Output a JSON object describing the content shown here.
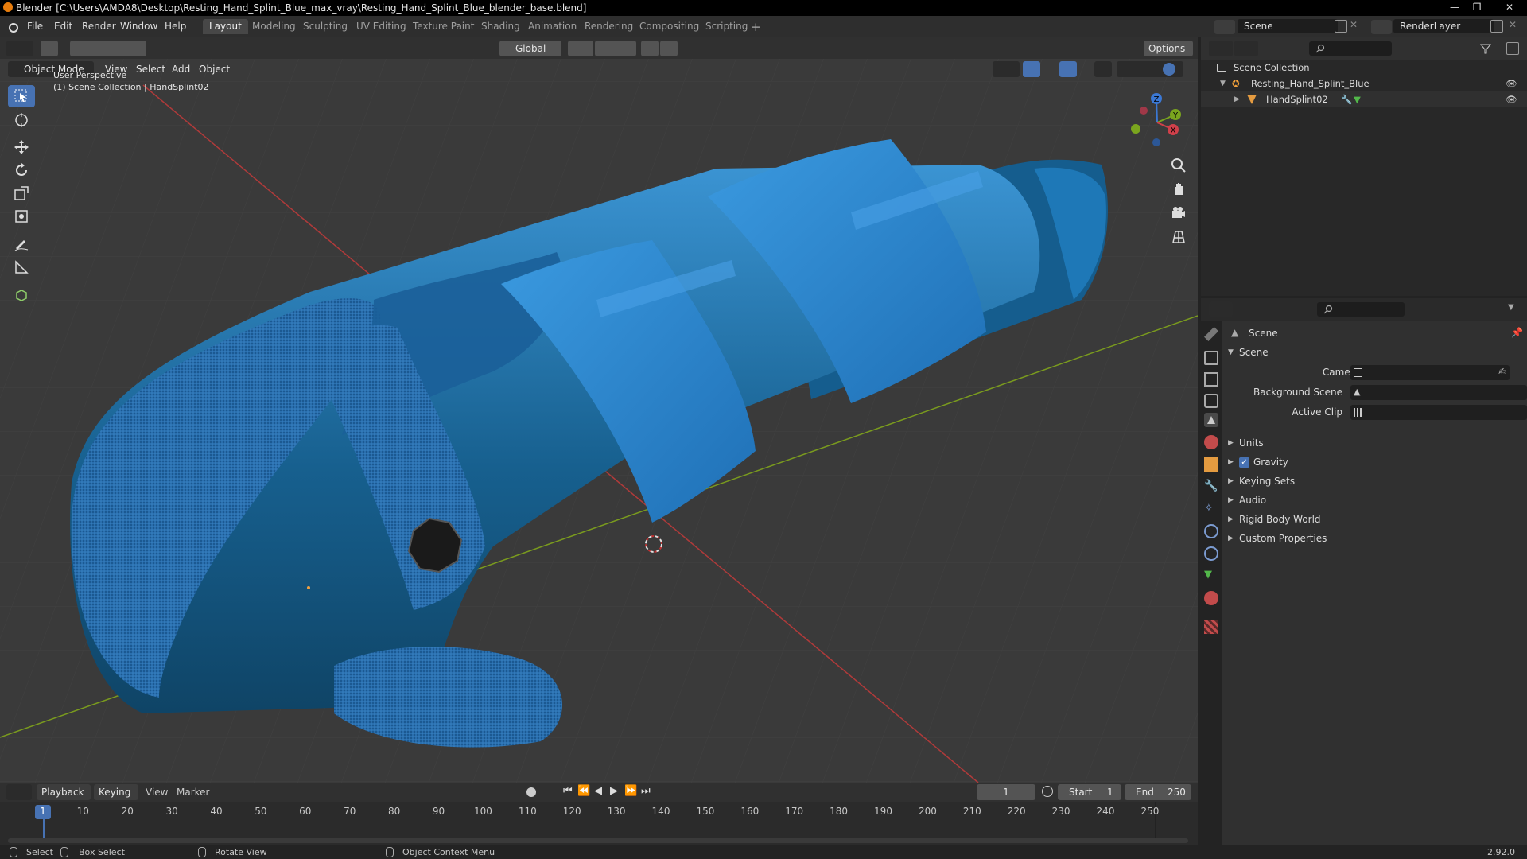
{
  "window": {
    "title": "Blender [C:\\Users\\AMDA8\\Desktop\\Resting_Hand_Splint_Blue_max_vray\\Resting_Hand_Splint_Blue_blender_base.blend]"
  },
  "menu": {
    "items": [
      "File",
      "Edit",
      "Render",
      "Window",
      "Help"
    ],
    "workspaces": [
      "Layout",
      "Modeling",
      "Sculpting",
      "UV Editing",
      "Texture Paint",
      "Shading",
      "Animation",
      "Rendering",
      "Compositing",
      "Scripting"
    ],
    "active_workspace": "Layout",
    "scene_name": "Scene",
    "view_layer": "RenderLayer"
  },
  "viewport": {
    "options_label": "Options",
    "transform_orientation": "Global",
    "mode": "Object Mode",
    "header_menus": [
      "View",
      "Select",
      "Add",
      "Object"
    ],
    "overlay_line1": "User Perspective",
    "overlay_line2": "(1) Scene Collection | HandSplint02",
    "gizmo_axes": {
      "x": "X",
      "y": "Y",
      "z": "Z"
    }
  },
  "outliner": {
    "root": "Scene Collection",
    "items": [
      {
        "name": "Resting_Hand_Splint_Blue"
      },
      {
        "name": "HandSplint02"
      }
    ]
  },
  "properties": {
    "context_title": "Scene",
    "panel_title": "Scene",
    "fields": [
      {
        "label": "Camera"
      },
      {
        "label": "Background Scene"
      },
      {
        "label": "Active Clip"
      }
    ],
    "subpanels": [
      "Units",
      "Gravity",
      "Keying Sets",
      "Audio",
      "Rigid Body World",
      "Custom Properties"
    ],
    "gravity_checked": true
  },
  "timeline": {
    "menus": [
      "Playback",
      "Keying",
      "View",
      "Marker"
    ],
    "current_frame": "1",
    "start_label": "Start",
    "start_value": "1",
    "end_label": "End",
    "end_value": "250",
    "ruler": [
      "1",
      "10",
      "20",
      "30",
      "40",
      "50",
      "60",
      "70",
      "80",
      "90",
      "100",
      "110",
      "120",
      "130",
      "140",
      "150",
      "160",
      "170",
      "180",
      "190",
      "200",
      "210",
      "220",
      "230",
      "240",
      "250"
    ]
  },
  "statusbar": {
    "select": "Select",
    "box_select": "Box Select",
    "rotate_view": "Rotate View",
    "context_menu": "Object Context Menu",
    "version": "2.92.0"
  },
  "colors": {
    "accent": "#4772b3",
    "splint_blue": "#1a76b8",
    "axis_x": "#b03a3a",
    "axis_y": "#7a9b1e"
  }
}
